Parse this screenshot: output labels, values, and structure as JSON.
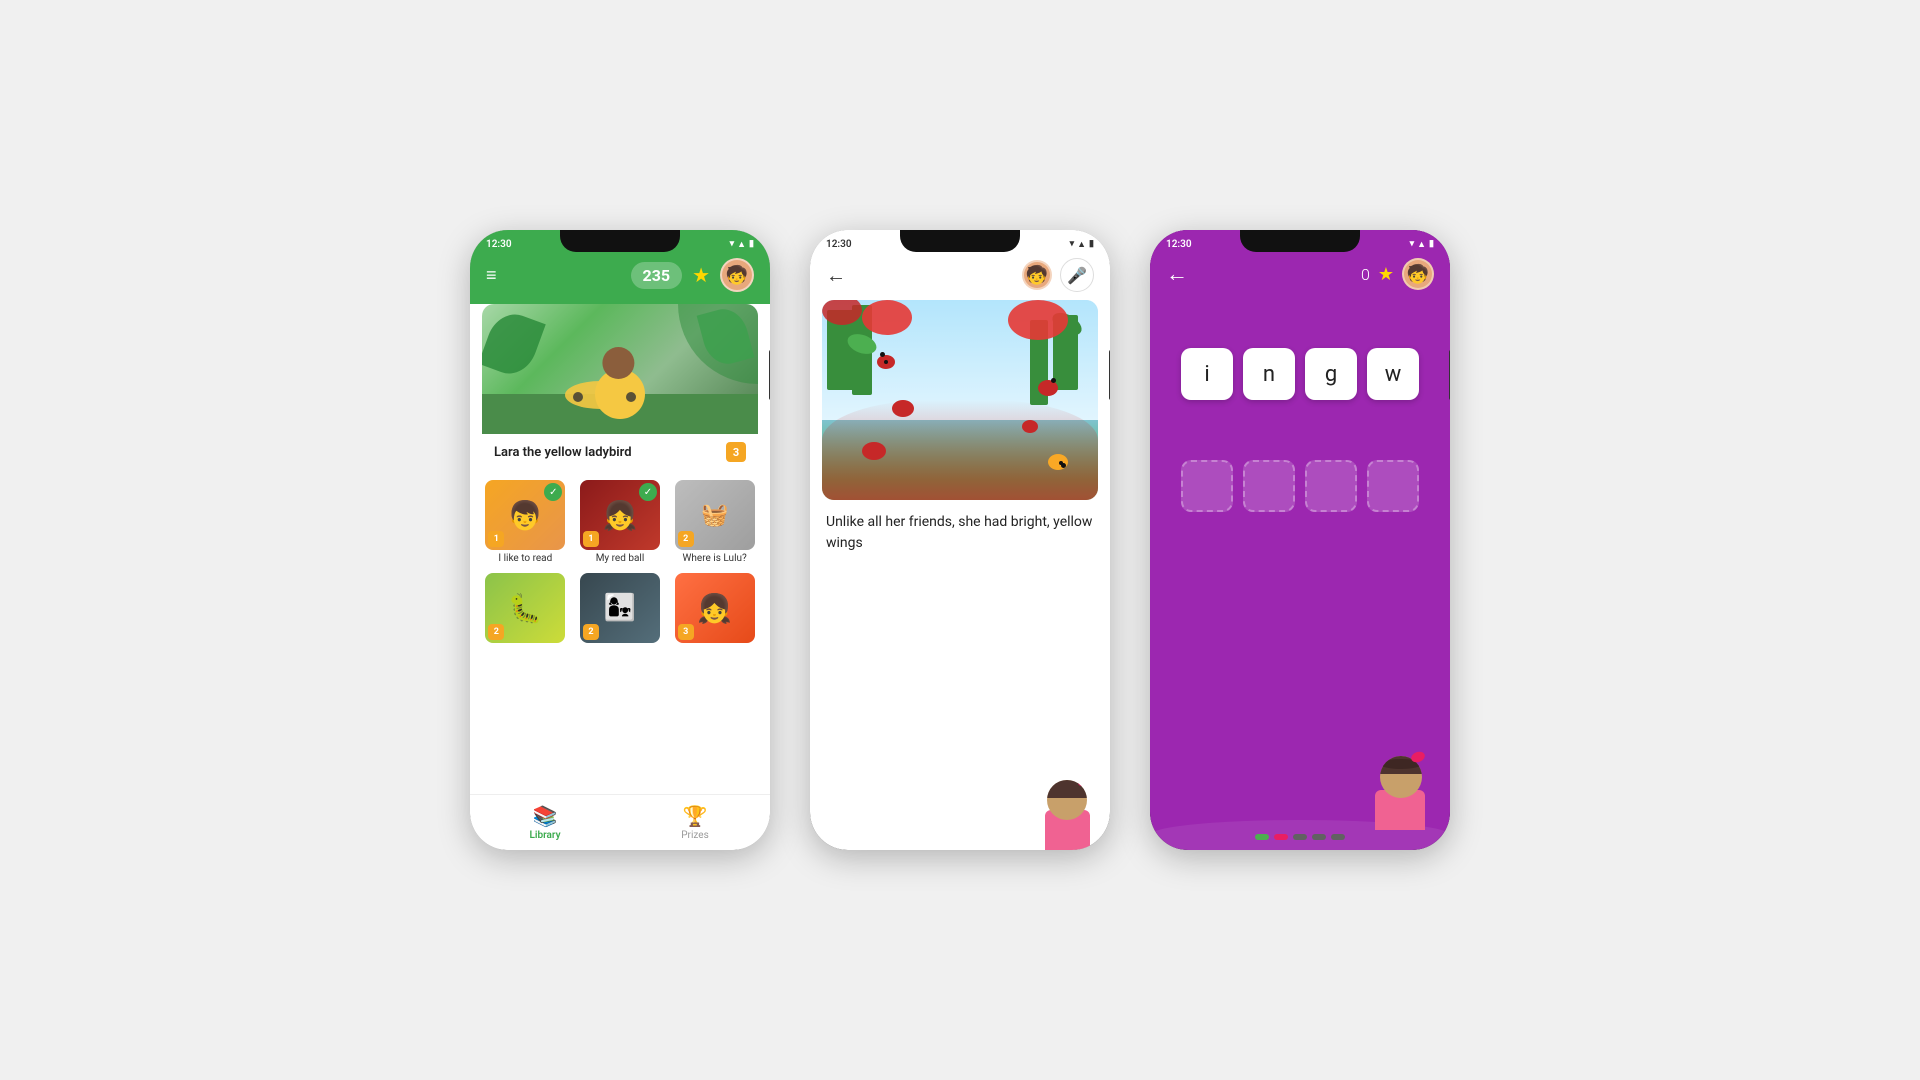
{
  "phone1": {
    "status": {
      "time": "12:30"
    },
    "header": {
      "score": "235"
    },
    "featured": {
      "title": "Lara the yellow ladybird",
      "level": "3"
    },
    "books": [
      {
        "title": "I like to read",
        "level": "1",
        "completed": true
      },
      {
        "title": "My red ball",
        "level": "1",
        "completed": true
      },
      {
        "title": "Where is Lulu?",
        "level": "2",
        "completed": false
      },
      {
        "title": "",
        "level": "2",
        "completed": false
      },
      {
        "title": "",
        "level": "2",
        "completed": false
      },
      {
        "title": "",
        "level": "3",
        "completed": false
      }
    ],
    "nav": {
      "library": "Library",
      "prizes": "Prizes"
    }
  },
  "phone2": {
    "status": {
      "time": "12:30"
    },
    "story_text": "Unlike all her friends, she had bright, yellow wings"
  },
  "phone3": {
    "status": {
      "time": "12:30"
    },
    "score": "0",
    "letters": [
      "i",
      "n",
      "g",
      "w"
    ],
    "progress_colors": [
      "#4caf50",
      "#e91e63",
      "#9e9e9e",
      "#9e9e9e",
      "#9e9e9e"
    ]
  }
}
